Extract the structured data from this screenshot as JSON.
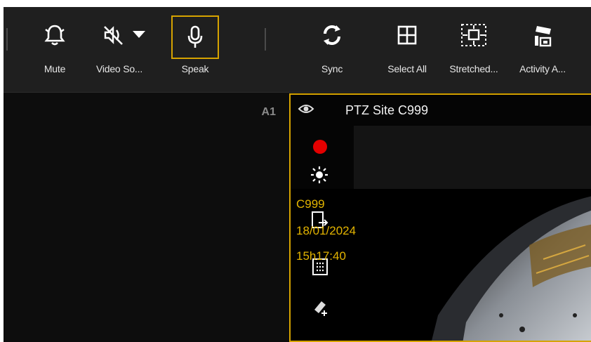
{
  "toolbar": {
    "tools": [
      {
        "id": "mute",
        "label": "Mute",
        "icon": "bell-icon"
      },
      {
        "id": "video-source",
        "label": "Video So...",
        "icon": "video-source-muted-icon"
      },
      {
        "id": "speak",
        "label": "Speak",
        "icon": "microphone-icon",
        "active": true
      },
      {
        "id": "sync",
        "label": "Sync",
        "icon": "sync-icon"
      },
      {
        "id": "select-all",
        "label": "Select All",
        "icon": "grid-icon"
      },
      {
        "id": "stretched",
        "label": "Stretched...",
        "icon": "stretch-icon"
      },
      {
        "id": "activity",
        "label": "Activity A...",
        "icon": "camera-activity-icon"
      }
    ]
  },
  "tiles": {
    "left": {
      "tag": "A1"
    },
    "right": {
      "title": "PTZ Site C999",
      "osd": {
        "camera": "C999",
        "date": "18/01/2024",
        "time": "15h17:40"
      }
    }
  },
  "colors": {
    "accent": "#d6a300",
    "record": "#e40000",
    "osd": "#e3b400"
  }
}
